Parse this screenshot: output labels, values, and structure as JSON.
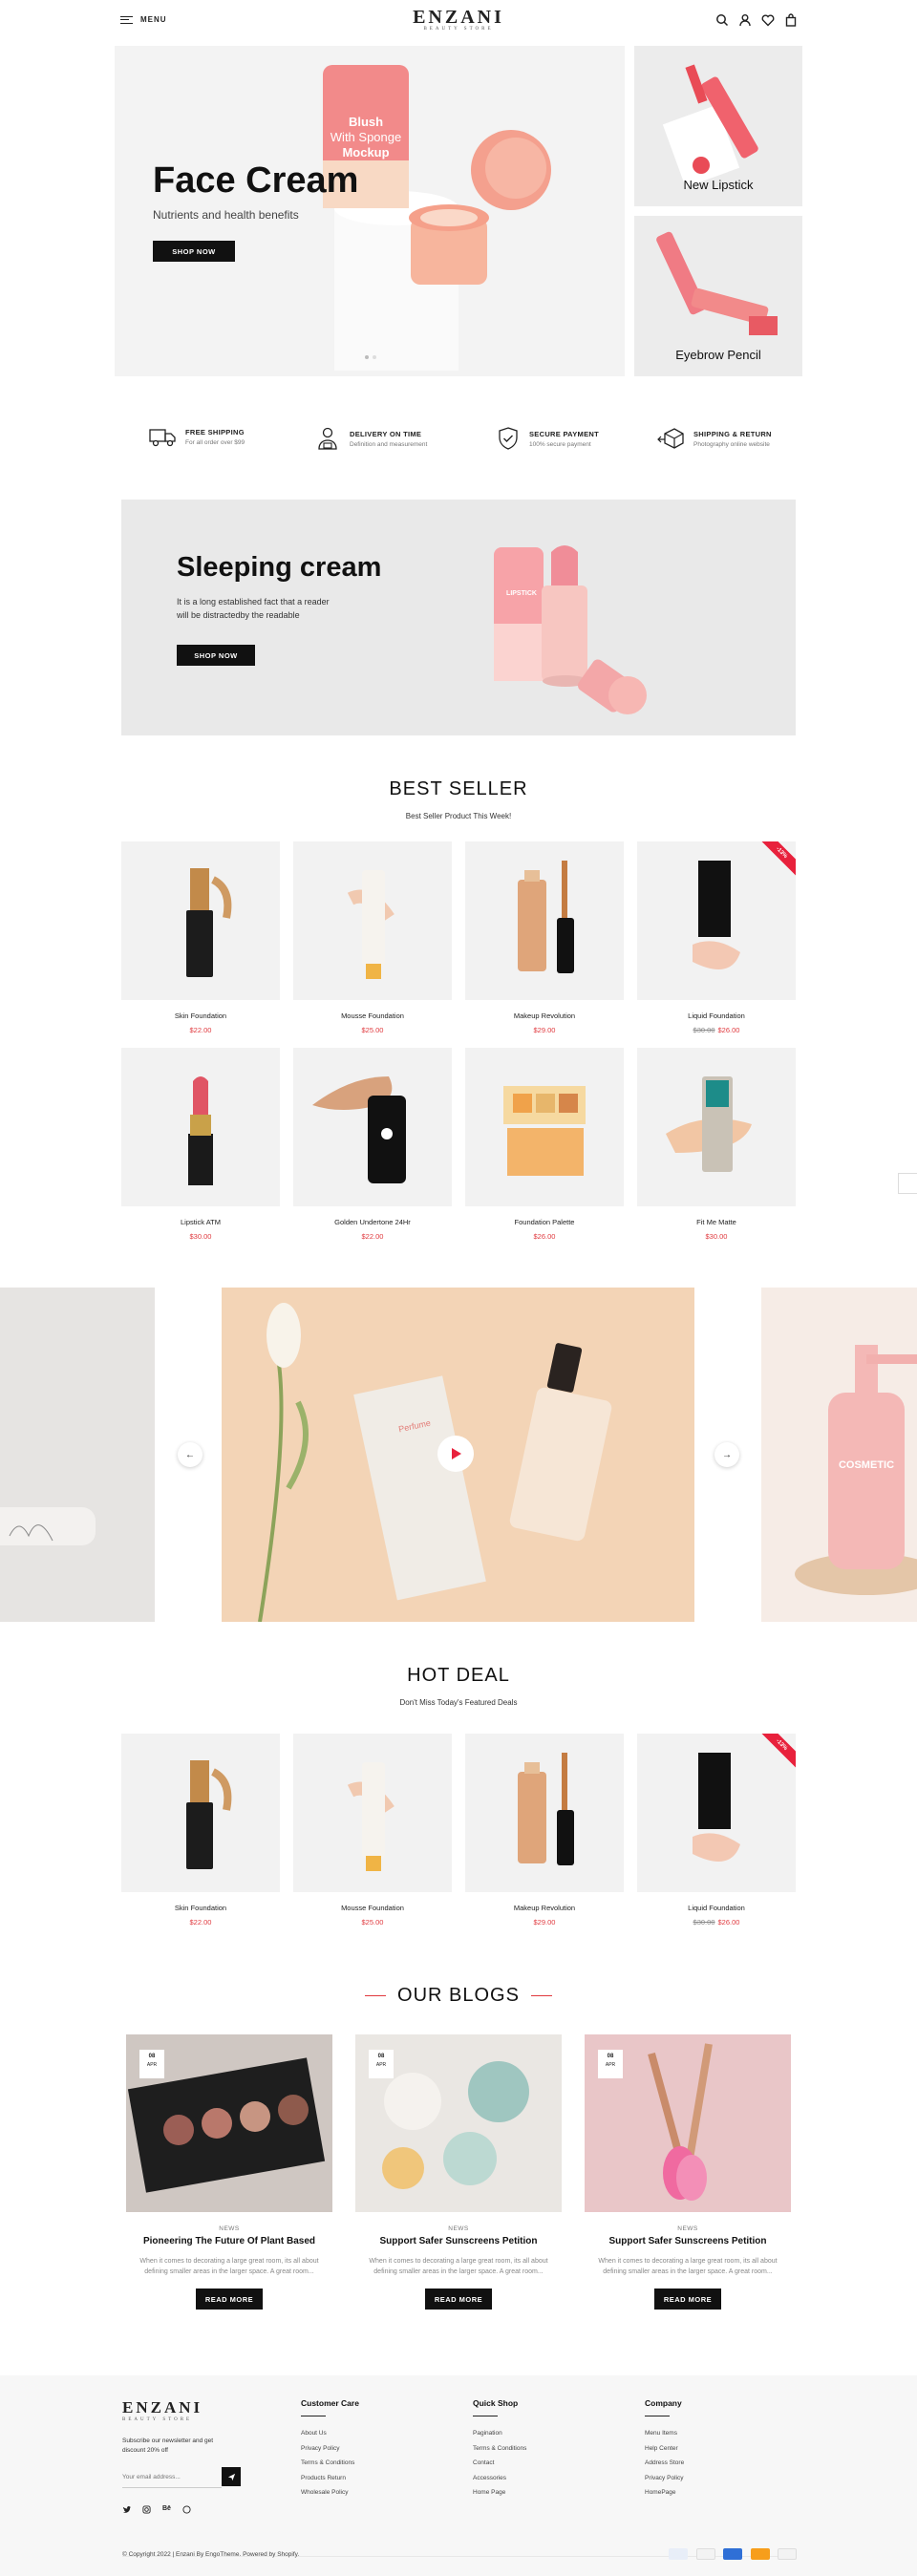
{
  "header": {
    "menu_label": "MENU",
    "logo_name": "ENZANI",
    "logo_sub": "BEAUTY STORE"
  },
  "hero": {
    "title": "Face Cream",
    "subtitle": "Nutrients and health benefits",
    "button": "SHOP NOW",
    "jar_label_1": "Blush",
    "jar_label_2": "With Sponge",
    "jar_label_3": "Mockup",
    "side1": "New Lipstick",
    "side2": "Eyebrow Pencil"
  },
  "features": [
    {
      "title": "FREE SHIPPING",
      "sub": "For all order over $99",
      "icon": "truck-icon"
    },
    {
      "title": "DELIVERY ON TIME",
      "sub": "Definition and measurement",
      "icon": "delivery-person-icon"
    },
    {
      "title": "SECURE PAYMENT",
      "sub": "100% secure payment",
      "icon": "shield-check-icon"
    },
    {
      "title": "SHIPPING & RETURN",
      "sub": "Photography online website",
      "icon": "box-return-icon"
    }
  ],
  "banner": {
    "title": "Sleeping cream",
    "text1": "It is a long established fact that a reader",
    "text2": "will be distractedby the readable",
    "button": "SHOP NOW",
    "lipstick_label": "LIPSTICK"
  },
  "best_seller": {
    "title": "BEST SELLER",
    "sub": "Best Seller Product This Week!",
    "products": [
      {
        "name": "Skin Foundation",
        "price": "$22.00",
        "old": ""
      },
      {
        "name": "Mousse Foundation",
        "price": "$25.00",
        "old": ""
      },
      {
        "name": "Makeup Revolution",
        "price": "$29.00",
        "old": ""
      },
      {
        "name": "Liquid Foundation",
        "price": "$26.00",
        "old": "$30.00",
        "badge": "-13%"
      },
      {
        "name": "Lipstick ATM",
        "price": "$30.00",
        "old": ""
      },
      {
        "name": "Golden Undertone 24Hr",
        "price": "$22.00",
        "old": ""
      },
      {
        "name": "Foundation Palette",
        "price": "$26.00",
        "old": ""
      },
      {
        "name": "Fit Me Matte",
        "price": "$30.00",
        "old": ""
      }
    ]
  },
  "slider": {
    "box_label": "Perfume",
    "right_label": "COSMETIC"
  },
  "hot_deal": {
    "title": "HOT DEAL",
    "sub": "Don't Miss Today's Featured Deals",
    "products": [
      {
        "name": "Skin Foundation",
        "price": "$22.00",
        "old": ""
      },
      {
        "name": "Mousse Foundation",
        "price": "$25.00",
        "old": ""
      },
      {
        "name": "Makeup Revolution",
        "price": "$29.00",
        "old": ""
      },
      {
        "name": "Liquid Foundation",
        "price": "$26.00",
        "old": "$30.00",
        "badge": "-13%"
      }
    ]
  },
  "blogs": {
    "title": "OUR BLOGS",
    "items": [
      {
        "day": "08",
        "month": "APR",
        "tag": "NEWS",
        "title": "Pioneering The Future Of Plant Based",
        "excerpt": "When it comes to decorating a large great room, its all about defining smaller areas in the larger space. A great room...",
        "button": "READ MORE"
      },
      {
        "day": "08",
        "month": "APR",
        "tag": "NEWS",
        "title": "Support Safer Sunscreens Petition",
        "excerpt": "When it comes to decorating a large great room, its all about defining smaller areas in the larger space. A great room...",
        "button": "READ MORE"
      },
      {
        "day": "08",
        "month": "APR",
        "tag": "NEWS",
        "title": "Support Safer Sunscreens Petition",
        "excerpt": "When it comes to decorating a large great room, its all about defining smaller areas in the larger space. A great room...",
        "button": "READ MORE"
      }
    ]
  },
  "footer": {
    "newsletter": "Subscribe our newsletter and get discount 20% off",
    "email_placeholder": "Your email address...",
    "customer_care": {
      "title": "Customer Care",
      "links": [
        "About Us",
        "Privacy Policy",
        "Terms & Conditions",
        "Products Return",
        "Wholesale Policy"
      ]
    },
    "quick_shop": {
      "title": "Quick Shop",
      "links": [
        "Pagination",
        "Terms & Conditions",
        "Contact",
        "Accessories",
        "Home Page"
      ]
    },
    "company": {
      "title": "Company",
      "links": [
        "Menu Items",
        "Help Center",
        "Address Store",
        "Privacy Policy",
        "HomePage"
      ]
    },
    "copyright": "© Copyright 2022 | Enzani By EngoTheme. Powered by Shopify.",
    "payments": [
      "VISA",
      "PayPal",
      "Amex",
      "Mastercard",
      "Discover"
    ]
  },
  "colors": {
    "accent": "#e0393e",
    "dark": "#111111",
    "pink": "#f0a4a4"
  }
}
